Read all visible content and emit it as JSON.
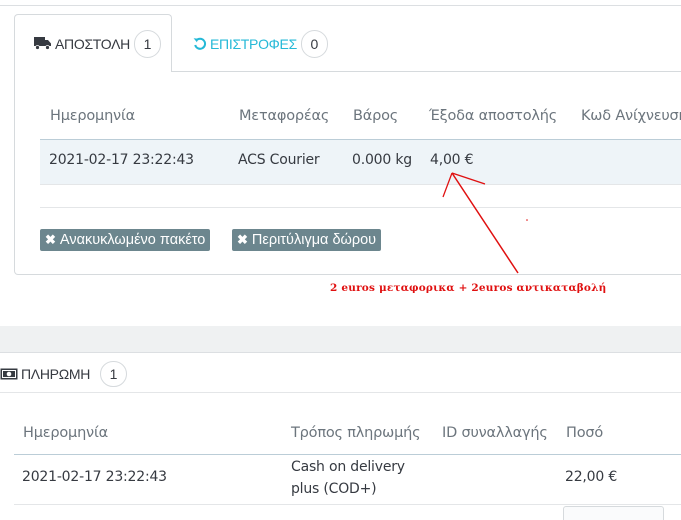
{
  "shipping": {
    "tabs": [
      {
        "label": "ΑΠΟΣΤΟΛΗ",
        "count": "1",
        "icon": "truck-icon",
        "active": true
      },
      {
        "label": "ΕΠΙΣΤΡΟΦΕΣ",
        "count": "0",
        "icon": "refresh-icon",
        "active": false
      }
    ],
    "columns": [
      "Ημερομηνία",
      "Μεταφορέας",
      "Βάρος",
      "Έξοδα αποστολής",
      "Κωδ Ανίχνευσης"
    ],
    "row": {
      "date": "2021-02-17 23:22:43",
      "carrier": "ACS Courier",
      "weight": "0.000 kg",
      "cost": "4,00 €"
    },
    "options": [
      "Ανακυκλωμένο πακέτο",
      "Περιτύλιγμα δώρου"
    ]
  },
  "annotation": {
    "text": "2 euros μεταφορικα + 2euros αντικαταβολή",
    "color": "#e01010"
  },
  "payment": {
    "title": "ΠΛΗΡΩΜΗ",
    "count": "1",
    "icon": "money-icon",
    "columns": [
      "Ημερομηνία",
      "Τρόπος πληρωμής",
      "ID συναλλαγής",
      "Ποσό"
    ],
    "row": {
      "date": "2021-02-17 23:22:43",
      "method_line1": "Cash on delivery",
      "method_line2": "plus (COD+)",
      "transaction_id": "",
      "amount": "22,00 €"
    }
  },
  "colors": {
    "accent": "#25b9d7",
    "chip": "#6c868e",
    "row_highlight": "#eef4f8"
  }
}
